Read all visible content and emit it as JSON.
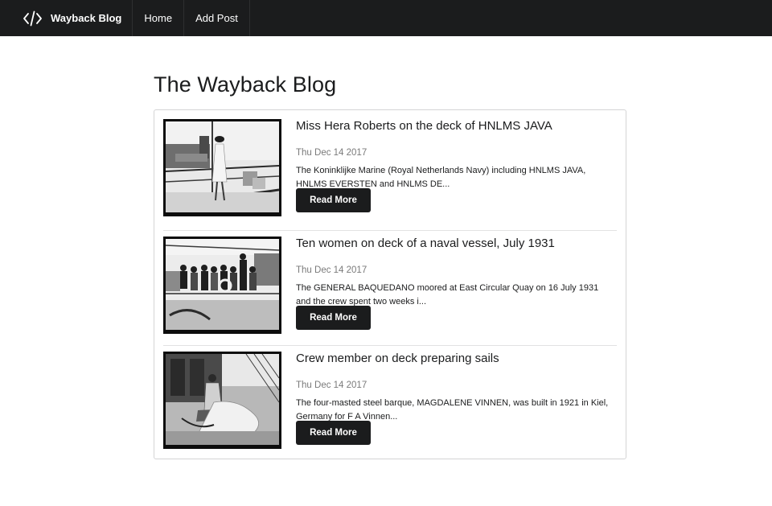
{
  "navbar": {
    "brand_icon": "code-icon",
    "brand": "Wayback Blog",
    "links": [
      "Home",
      "Add Post"
    ]
  },
  "page": {
    "title": "The Wayback Blog"
  },
  "posts": [
    {
      "title": "Miss Hera Roberts on the deck of HNLMS JAVA",
      "date": "Thu Dec 14 2017",
      "excerpt": "The Koninklijke Marine (Royal Netherlands Navy) including HNLMS JAVA, HNLMS EVERSTEN and HNLMS DE...",
      "button": "Read More"
    },
    {
      "title": "Ten women on deck of a naval vessel, July 1931",
      "date": "Thu Dec 14 2017",
      "excerpt": "The GENERAL BAQUEDANO moored at East Circular Quay on 16 July 1931 and the crew spent two weeks i...",
      "button": "Read More"
    },
    {
      "title": "Crew member on deck preparing sails",
      "date": "Thu Dec 14 2017",
      "excerpt": "The four-masted steel barque, MAGDALENE VINNEN, was built in 1921 in Kiel, Germany for F A Vinnen...",
      "button": "Read More"
    }
  ]
}
